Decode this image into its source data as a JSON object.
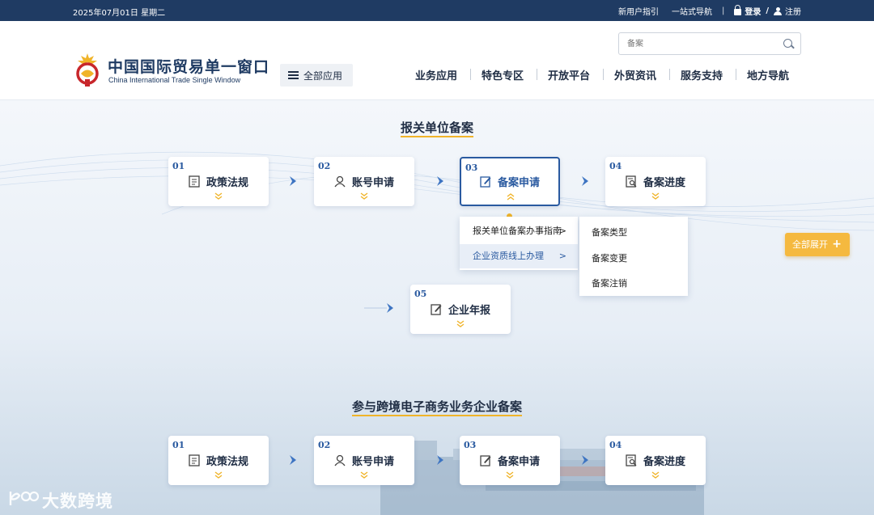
{
  "topbar": {
    "date": "2025年07月01日 星期二",
    "new_user": "新用户指引",
    "one_stop": "一站式导航",
    "divider": "|",
    "login": "登录",
    "slash": "/",
    "register": "注册"
  },
  "header": {
    "search_placeholder": "备案",
    "logo_cn": "中国国际贸易单一窗口",
    "logo_en": "China International Trade Single Window",
    "all_apps": "全部应用",
    "nav": [
      "业务应用",
      "特色专区",
      "开放平台",
      "外贸资讯",
      "服务支持",
      "地方导航"
    ]
  },
  "section1": {
    "title": "报关单位备案",
    "steps": [
      {
        "num": "01",
        "label": "政策法规",
        "icon": "document-icon"
      },
      {
        "num": "02",
        "label": "账号申请",
        "icon": "user-icon"
      },
      {
        "num": "03",
        "label": "备案申请",
        "icon": "edit-icon"
      },
      {
        "num": "04",
        "label": "备案进度",
        "icon": "search-document-icon"
      },
      {
        "num": "05",
        "label": "企业年报",
        "icon": "edit-icon"
      }
    ],
    "dropdown_main": [
      {
        "label": "报关单位备案办事指南",
        "arrow": ">"
      },
      {
        "label": "企业资质线上办理",
        "arrow": ">"
      }
    ],
    "dropdown_sub": [
      "备案类型",
      "备案变更",
      "备案注销"
    ]
  },
  "expand_button": {
    "label": "全部展开",
    "icon": "+"
  },
  "section2": {
    "title": "参与跨境电子商务业务企业备案",
    "steps": [
      {
        "num": "01",
        "label": "政策法规",
        "icon": "document-icon"
      },
      {
        "num": "02",
        "label": "账号申请",
        "icon": "user-icon"
      },
      {
        "num": "03",
        "label": "备案申请",
        "icon": "edit-icon"
      },
      {
        "num": "04",
        "label": "备案进度",
        "icon": "search-document-icon"
      }
    ]
  },
  "watermark": "大数跨境",
  "colors": {
    "navy": "#1f3b63",
    "accent_blue": "#2a5aa0",
    "gold": "#f0b429",
    "expand_orange": "#f5b93f"
  }
}
